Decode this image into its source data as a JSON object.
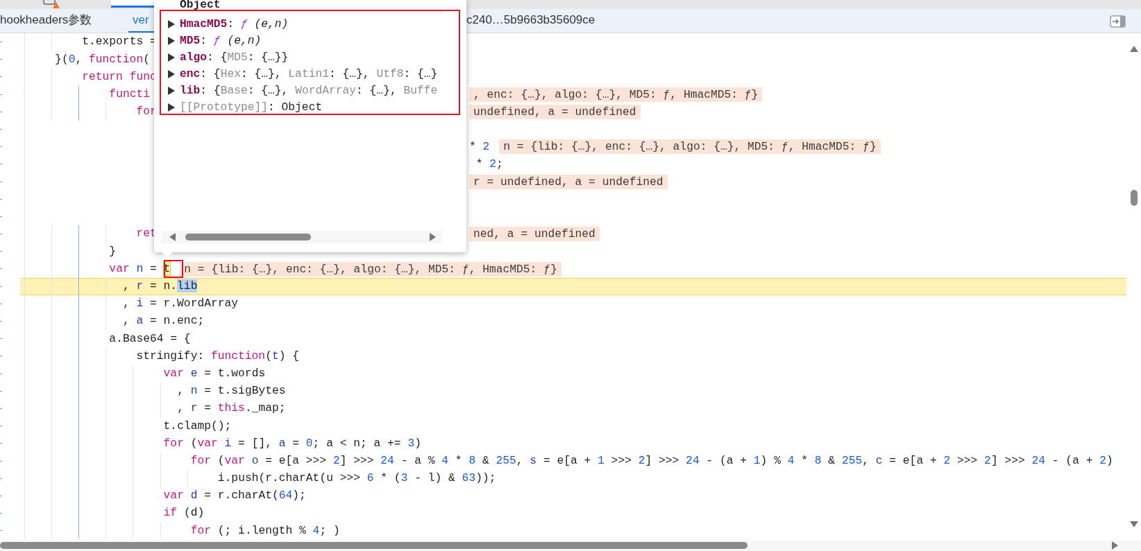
{
  "tabs": [
    {
      "label": "hookheaders参数",
      "selected": false
    },
    {
      "label": "ver",
      "selected": true
    },
    {
      "label": "c240…5b9663b35609ce",
      "selected": false
    }
  ],
  "editor": {
    "lines": [
      {
        "current": false,
        "code": [
          {
            "text": "        t.exports =",
            "kind": "plain"
          }
        ]
      },
      {
        "current": false,
        "code": [
          {
            "text": "    }(",
            "kind": "plain"
          },
          {
            "text": "0",
            "kind": "number"
          },
          {
            "text": ", ",
            "kind": "plain"
          },
          {
            "text": "function",
            "kind": "keyword"
          },
          {
            "text": "(",
            "kind": "plain"
          }
        ]
      },
      {
        "current": false,
        "code": [
          {
            "text": "        return func",
            "kind": "keyword"
          }
        ]
      },
      {
        "current": false,
        "code": [
          {
            "text": "            functi",
            "kind": "keyword"
          }
        ],
        "after_popover": [
          {
            "text": ", enc: {…}, algo: {…}, MD5: ƒ, HmacMD5: ƒ}",
            "kind": "note"
          }
        ]
      },
      {
        "current": false,
        "code": [
          {
            "text": "                for",
            "kind": "keyword"
          }
        ],
        "after_popover": [
          {
            "text": "undefined, a = undefined",
            "kind": "note"
          }
        ]
      },
      {
        "current": false
      },
      {
        "current": false,
        "after_popover": [
          {
            "text": "* ",
            "kind": "plain"
          },
          {
            "text": "2",
            "kind": "number"
          },
          {
            "text": "n = {lib: {…}, enc: {…}, algo: {…}, MD5: ƒ, HmacMD5: ƒ}",
            "kind": "note"
          }
        ]
      },
      {
        "current": false,
        "after_popover": [
          {
            "text": " * ",
            "kind": "plain"
          },
          {
            "text": "2",
            "kind": "number"
          },
          {
            "text": ";",
            "kind": "plain"
          }
        ]
      },
      {
        "current": false,
        "after_popover": [
          {
            "text": "r = undefined, a = undefined",
            "kind": "note"
          }
        ]
      },
      {
        "current": false
      },
      {
        "current": false
      },
      {
        "current": false,
        "code": [
          {
            "text": "                ret",
            "kind": "keyword"
          }
        ],
        "after_popover": [
          {
            "text": "ned, a = undefined",
            "kind": "note"
          }
        ]
      },
      {
        "current": false,
        "code": [
          {
            "text": "            }",
            "kind": "plain"
          }
        ]
      },
      {
        "current": false,
        "code": [
          {
            "text": "            var ",
            "kind": "keyword"
          },
          {
            "text": "n",
            "kind": "def"
          },
          {
            "text": " = ",
            "kind": "plain"
          },
          {
            "text": "t",
            "kind": "hover"
          },
          {
            "text": "n = {lib: {…}, enc: {…}, algo: {…}, MD5: ƒ, HmacMD5: ƒ}",
            "kind": "note"
          }
        ]
      },
      {
        "current": true,
        "code": [
          {
            "text": "              , ",
            "kind": "plain"
          },
          {
            "text": "r",
            "kind": "def"
          },
          {
            "text": " = n.",
            "kind": "plain"
          },
          {
            "text": "lib",
            "kind": "selection"
          }
        ]
      },
      {
        "current": false,
        "code": [
          {
            "text": "              , ",
            "kind": "plain"
          },
          {
            "text": "i",
            "kind": "def"
          },
          {
            "text": " = r.WordArray",
            "kind": "plain"
          }
        ]
      },
      {
        "current": false,
        "code": [
          {
            "text": "              , ",
            "kind": "plain"
          },
          {
            "text": "a",
            "kind": "def"
          },
          {
            "text": " = n.enc;",
            "kind": "plain"
          }
        ]
      },
      {
        "current": false,
        "code": [
          {
            "text": "            a.Base64 = {",
            "kind": "plain"
          }
        ]
      },
      {
        "current": false,
        "code": [
          {
            "text": "                stringify: ",
            "kind": "plain"
          },
          {
            "text": "function",
            "kind": "keyword"
          },
          {
            "text": "(",
            "kind": "plain"
          },
          {
            "text": "t",
            "kind": "def"
          },
          {
            "text": ") {",
            "kind": "plain"
          }
        ]
      },
      {
        "current": false,
        "code": [
          {
            "text": "                    var ",
            "kind": "keyword"
          },
          {
            "text": "e",
            "kind": "def"
          },
          {
            "text": " = t.words",
            "kind": "plain"
          }
        ]
      },
      {
        "current": false,
        "code": [
          {
            "text": "                      , ",
            "kind": "plain"
          },
          {
            "text": "n",
            "kind": "def"
          },
          {
            "text": " = t.sigBytes",
            "kind": "plain"
          }
        ]
      },
      {
        "current": false,
        "code": [
          {
            "text": "                      , ",
            "kind": "plain"
          },
          {
            "text": "r",
            "kind": "def"
          },
          {
            "text": " = ",
            "kind": "plain"
          },
          {
            "text": "this",
            "kind": "keyword"
          },
          {
            "text": "._map;",
            "kind": "plain"
          }
        ]
      },
      {
        "current": false,
        "code": [
          {
            "text": "                    t.clamp();",
            "kind": "plain"
          }
        ]
      },
      {
        "current": false,
        "code": [
          {
            "text": "                    for",
            "kind": "keyword"
          },
          {
            "text": " (",
            "kind": "plain"
          },
          {
            "text": "var ",
            "kind": "keyword"
          },
          {
            "text": "i",
            "kind": "def"
          },
          {
            "text": " = [], ",
            "kind": "plain"
          },
          {
            "text": "a",
            "kind": "def"
          },
          {
            "text": " = ",
            "kind": "plain"
          },
          {
            "text": "0",
            "kind": "number"
          },
          {
            "text": "; a < n; a += ",
            "kind": "plain"
          },
          {
            "text": "3",
            "kind": "number"
          },
          {
            "text": ")",
            "kind": "plain"
          }
        ]
      },
      {
        "current": false,
        "code": [
          {
            "text": "                        for",
            "kind": "keyword"
          },
          {
            "text": " (",
            "kind": "plain"
          },
          {
            "text": "var ",
            "kind": "keyword"
          },
          {
            "text": "o",
            "kind": "def"
          },
          {
            "text": " = e[a >>> ",
            "kind": "plain"
          },
          {
            "text": "2",
            "kind": "number"
          },
          {
            "text": "] >>> ",
            "kind": "plain"
          },
          {
            "text": "24",
            "kind": "number"
          },
          {
            "text": " - a % ",
            "kind": "plain"
          },
          {
            "text": "4",
            "kind": "number"
          },
          {
            "text": " * ",
            "kind": "plain"
          },
          {
            "text": "8",
            "kind": "number"
          },
          {
            "text": " & ",
            "kind": "plain"
          },
          {
            "text": "255",
            "kind": "number"
          },
          {
            "text": ", ",
            "kind": "plain"
          },
          {
            "text": "s",
            "kind": "def"
          },
          {
            "text": " = e[a + ",
            "kind": "plain"
          },
          {
            "text": "1",
            "kind": "number"
          },
          {
            "text": " >>> ",
            "kind": "plain"
          },
          {
            "text": "2",
            "kind": "number"
          },
          {
            "text": "] >>> ",
            "kind": "plain"
          },
          {
            "text": "24",
            "kind": "number"
          },
          {
            "text": " - (a + ",
            "kind": "plain"
          },
          {
            "text": "1",
            "kind": "number"
          },
          {
            "text": ") % ",
            "kind": "plain"
          },
          {
            "text": "4",
            "kind": "number"
          },
          {
            "text": " * ",
            "kind": "plain"
          },
          {
            "text": "8",
            "kind": "number"
          },
          {
            "text": " & ",
            "kind": "plain"
          },
          {
            "text": "255",
            "kind": "number"
          },
          {
            "text": ", ",
            "kind": "plain"
          },
          {
            "text": "c",
            "kind": "def"
          },
          {
            "text": " = e[a + ",
            "kind": "plain"
          },
          {
            "text": "2",
            "kind": "number"
          },
          {
            "text": " >>> ",
            "kind": "plain"
          },
          {
            "text": "2",
            "kind": "number"
          },
          {
            "text": "] >>> ",
            "kind": "plain"
          },
          {
            "text": "24",
            "kind": "number"
          },
          {
            "text": " - (a + ",
            "kind": "plain"
          },
          {
            "text": "2",
            "kind": "number"
          },
          {
            "text": ")",
            "kind": "plain"
          }
        ]
      },
      {
        "current": false,
        "code": [
          {
            "text": "                            i.push(r.charAt(u >>> ",
            "kind": "plain"
          },
          {
            "text": "6",
            "kind": "number"
          },
          {
            "text": " * (",
            "kind": "plain"
          },
          {
            "text": "3",
            "kind": "number"
          },
          {
            "text": " - l) & ",
            "kind": "plain"
          },
          {
            "text": "63",
            "kind": "number"
          },
          {
            "text": "));",
            "kind": "plain"
          }
        ]
      },
      {
        "current": false,
        "code": [
          {
            "text": "                    var ",
            "kind": "keyword"
          },
          {
            "text": "d",
            "kind": "def"
          },
          {
            "text": " = r.charAt(",
            "kind": "plain"
          },
          {
            "text": "64",
            "kind": "number"
          },
          {
            "text": ");",
            "kind": "plain"
          }
        ]
      },
      {
        "current": false,
        "code": [
          {
            "text": "                    if",
            "kind": "keyword"
          },
          {
            "text": " (d)",
            "kind": "plain"
          }
        ]
      },
      {
        "current": false,
        "code": [
          {
            "text": "                        for",
            "kind": "keyword"
          },
          {
            "text": " (; i.length % ",
            "kind": "plain"
          },
          {
            "text": "4",
            "kind": "number"
          },
          {
            "text": "; )",
            "kind": "plain"
          }
        ]
      }
    ]
  },
  "popover": {
    "title": "Object",
    "properties": [
      {
        "expanded": false,
        "parts": [
          {
            "text": "HmacMD5",
            "kind": "key"
          },
          {
            "text": ": ",
            "kind": "plain"
          },
          {
            "text": "ƒ",
            "kind": "func"
          },
          {
            "text": " (e,n)",
            "kind": "italic"
          }
        ]
      },
      {
        "expanded": false,
        "parts": [
          {
            "text": "MD5",
            "kind": "key"
          },
          {
            "text": ": ",
            "kind": "plain"
          },
          {
            "text": "ƒ",
            "kind": "func"
          },
          {
            "text": " (e,n)",
            "kind": "italic"
          }
        ]
      },
      {
        "expanded": false,
        "parts": [
          {
            "text": "algo",
            "kind": "key"
          },
          {
            "text": ": {",
            "kind": "plain"
          },
          {
            "text": "MD5",
            "kind": "faded"
          },
          {
            "text": ": {…}}",
            "kind": "plain"
          }
        ]
      },
      {
        "expanded": false,
        "parts": [
          {
            "text": "enc",
            "kind": "key"
          },
          {
            "text": ": {",
            "kind": "plain"
          },
          {
            "text": "Hex",
            "kind": "faded"
          },
          {
            "text": ": {…}, ",
            "kind": "plain"
          },
          {
            "text": "Latin1",
            "kind": "faded"
          },
          {
            "text": ": {…}, ",
            "kind": "plain"
          },
          {
            "text": "Utf8",
            "kind": "faded"
          },
          {
            "text": ": {…}",
            "kind": "plain"
          }
        ]
      },
      {
        "expanded": false,
        "parts": [
          {
            "text": "lib",
            "kind": "key"
          },
          {
            "text": ": {",
            "kind": "plain"
          },
          {
            "text": "Base",
            "kind": "faded"
          },
          {
            "text": ": {…}, ",
            "kind": "plain"
          },
          {
            "text": "WordArray",
            "kind": "faded"
          },
          {
            "text": ": {…}, ",
            "kind": "plain"
          },
          {
            "text": "Buffe",
            "kind": "faded"
          }
        ]
      },
      {
        "expanded": false,
        "parts": [
          {
            "text": "[[Prototype]]",
            "kind": "faded"
          },
          {
            "text": ": Object",
            "kind": "plain"
          }
        ]
      }
    ]
  }
}
